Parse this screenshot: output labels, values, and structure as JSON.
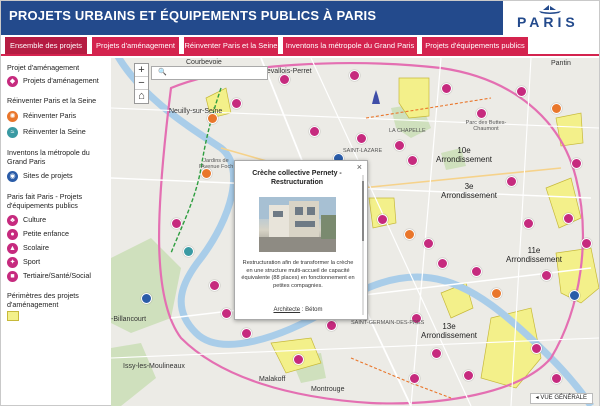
{
  "header": {
    "title": "PROJETS URBAINS ET ÉQUIPEMENTS PUBLICS À PARIS",
    "logo_text": "PARIS"
  },
  "tabs": [
    {
      "label": "Ensemble des projets"
    },
    {
      "label": "Projets d'aménagement"
    },
    {
      "label": "Réinventer Paris et la Seine"
    },
    {
      "label": "Inventons la métropole du Grand Paris"
    },
    {
      "label": "Projets d'équipements publics"
    }
  ],
  "legend": {
    "s1_title": "Projet d'aménagement",
    "s1_item": "Projets d'aménagement",
    "s2_title": "Réinventer Paris et la Seine",
    "s2_items": [
      "Réinventer Paris",
      "Réinventer la Seine"
    ],
    "s3_title": "Inventons la métropole du Grand Paris",
    "s3_item": "Sites de projets",
    "s4_title": "Paris fait Paris - Projets d'équipements publics",
    "s4_items": [
      "Culture",
      "Petite enfance",
      "Scolaire",
      "Sport",
      "Tertiaire/Santé/Social"
    ],
    "s5_title": "Périmètres des projets d'aménagement"
  },
  "map": {
    "search_placeholder": "",
    "labels": {
      "courbevoie": "Courbevoie",
      "neuilly": "Neuilly-sur-Seine",
      "levallois": "Levallois-Perret",
      "jardins": "Jardins de l'Avenue Foch",
      "arr10": "10e\nArrondissement",
      "arr3": "3e\nArrondissement",
      "arr11": "11e\nArrondissement",
      "arr13": "13e\nArrondissement",
      "billancourt": "-Billancourt",
      "issy": "Issy-les-Moulineaux",
      "malakoff": "Malakoff",
      "montrouge": "Montrouge",
      "pantin": "Pantin",
      "buttes": "Parc des Buttes-Chaumont",
      "lachapelle": "LA CHAPELLE",
      "saintlazare": "SAINT-LAZARE",
      "saintgermain": "SAINT-GERMAIN-DES-PRÉS"
    },
    "vue_generale": "VUE GÉNÉRALE"
  },
  "popup": {
    "title": "Crèche collective Pernety - Restructuration",
    "close": "×",
    "text": "Restructuration afin de transformer la crèche en une structure multi-accueil de capacité équivalente (88 places) en fonctionnement en petites compagnies.",
    "architect_label": "Architecte",
    "architect_value": ": Bétom"
  },
  "colors": {
    "header_bg": "#234a8c",
    "tab_bg": "#d4234e",
    "marker_pink": "#c62a7e",
    "marker_orange": "#e9762b",
    "marker_blue": "#2a5ca8",
    "perimeter": "#f3f08a"
  }
}
